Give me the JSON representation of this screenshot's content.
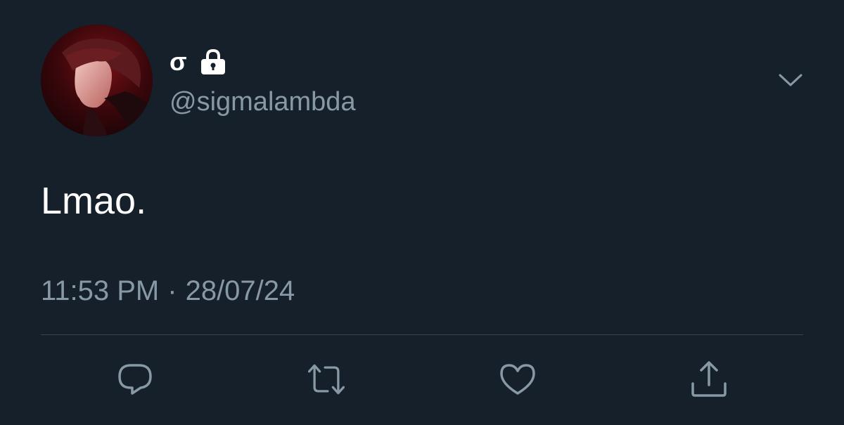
{
  "tweet": {
    "display_name": "σ",
    "protected_icon": "lock-icon",
    "handle": "@sigmalambda",
    "menu_icon": "chevron-down-icon",
    "text": "Lmao.",
    "time": "11:53 PM",
    "separator": "·",
    "date": "28/07/24"
  },
  "actions": [
    {
      "icon": "reply-icon"
    },
    {
      "icon": "retweet-icon"
    },
    {
      "icon": "like-icon"
    },
    {
      "icon": "share-icon"
    }
  ],
  "colors": {
    "background": "#15202b",
    "primary_text": "#ffffff",
    "secondary_text": "#8899a6",
    "divider": "#38444d"
  }
}
